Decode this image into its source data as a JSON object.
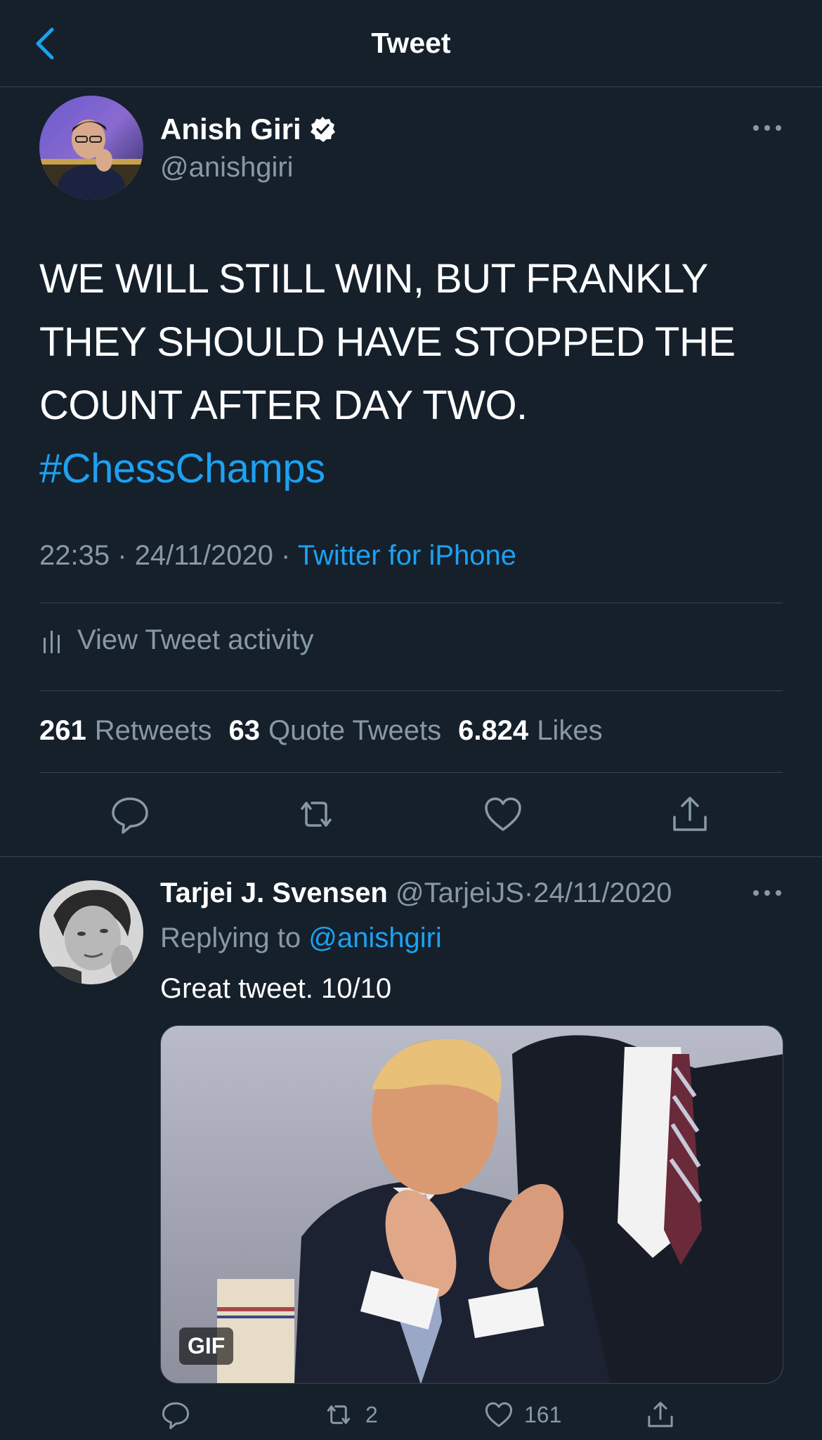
{
  "header": {
    "title": "Tweet",
    "back_icon": "chevron-left-icon"
  },
  "tweet": {
    "author": {
      "name": "Anish Giri",
      "handle": "@anishgiri",
      "verified": true
    },
    "text_lines": [
      "WE WILL STILL WIN, BUT FRANKLY",
      "THEY SHOULD HAVE STOPPED THE",
      "COUNT AFTER DAY TWO."
    ],
    "hashtag": "#ChessChamps",
    "time": "22:35",
    "date": "24/11/2020",
    "source": "Twitter for iPhone",
    "separator": "·",
    "activity_label": "View Tweet activity",
    "stats": {
      "retweets": {
        "count": "261",
        "label": "Retweets"
      },
      "quotes": {
        "count": "63",
        "label": "Quote Tweets"
      },
      "likes": {
        "count": "6.824",
        "label": "Likes"
      }
    }
  },
  "reply": {
    "author": {
      "name": "Tarjei J. Svensen",
      "handle": "@TarjeiJS"
    },
    "date": "24/11/2020",
    "separator": "·",
    "replying_prefix": "Replying to",
    "replying_to": "@anishgiri",
    "text": "Great tweet. 10/10",
    "media_badge": "GIF",
    "retweet_count": "2",
    "like_count": "161"
  },
  "colors": {
    "background": "#15202b",
    "accent": "#1da1f2",
    "secondary_text": "#8899a6",
    "divider": "#38444d"
  }
}
